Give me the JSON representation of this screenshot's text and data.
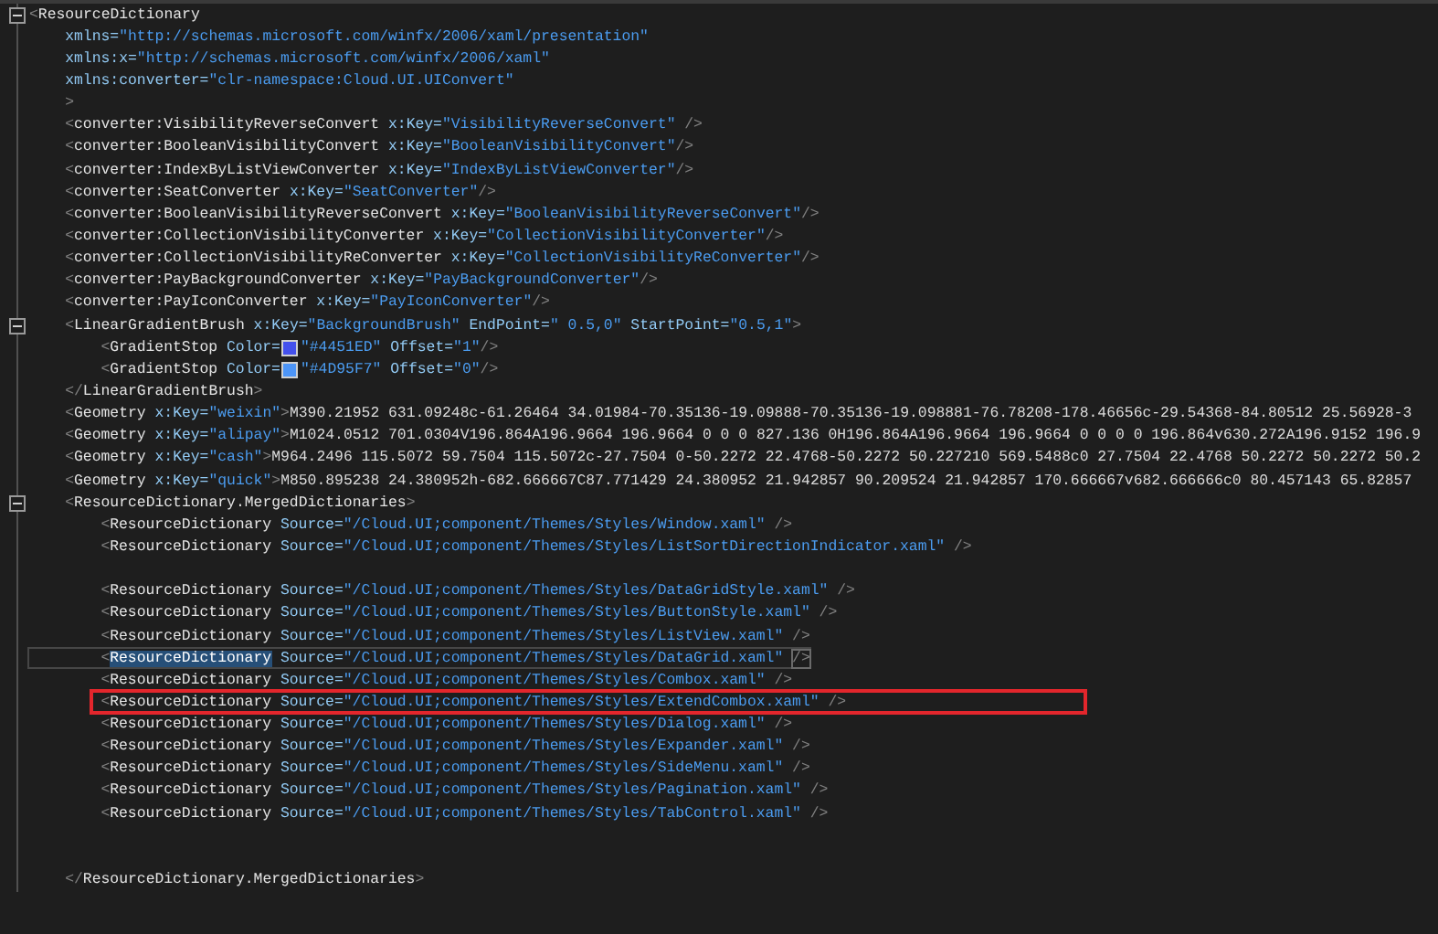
{
  "editor": {
    "lines": [
      {
        "kind": "code",
        "expanded": true,
        "tokens": [
          {
            "kind": "bracket",
            "text": "<"
          },
          {
            "kind": "tag",
            "text": "ResourceDictionary"
          }
        ],
        "children": [
          {
            "kind": "code",
            "tokens": [
              {
                "kind": "attr",
                "text": "xmlns="
              },
              {
                "kind": "value",
                "text": "\"http://schemas.microsoft.com/winfx/2006/xaml/presentation\""
              }
            ]
          },
          {
            "kind": "code",
            "tokens": [
              {
                "kind": "attr",
                "text": "xmlns:x="
              },
              {
                "kind": "value",
                "text": "\"http://schemas.microsoft.com/winfx/2006/xaml\""
              }
            ]
          },
          {
            "kind": "code",
            "tokens": [
              {
                "kind": "attr",
                "text": "xmlns:converter="
              },
              {
                "kind": "value",
                "text": "\"clr-namespace:Cloud.UI.UIConvert\""
              }
            ]
          },
          {
            "kind": "code",
            "tokens": [
              {
                "kind": "bracket",
                "text": ">"
              }
            ]
          },
          {
            "kind": "code",
            "tokens": [
              {
                "kind": "bracket",
                "text": "<"
              },
              {
                "kind": "tag",
                "text": "converter:VisibilityReverseConvert"
              },
              {
                "kind": "attr",
                "text": " x:Key="
              },
              {
                "kind": "value",
                "text": "\"VisibilityReverseConvert\""
              },
              {
                "kind": "bracket",
                "text": " />"
              }
            ]
          },
          {
            "kind": "code",
            "tokens": [
              {
                "kind": "bracket",
                "text": "<"
              },
              {
                "kind": "tag",
                "text": "converter:BooleanVisibilityConvert"
              },
              {
                "kind": "attr",
                "text": " x:Key="
              },
              {
                "kind": "value",
                "text": "\"BooleanVisibilityConvert\""
              },
              {
                "kind": "bracket",
                "text": "/>"
              }
            ]
          },
          {
            "kind": "code",
            "tokens": [
              {
                "kind": "bracket",
                "text": "<"
              },
              {
                "kind": "tag",
                "text": "converter:IndexByListViewConverter"
              },
              {
                "kind": "attr",
                "text": " x:Key="
              },
              {
                "kind": "value",
                "text": "\"IndexByListViewConverter\""
              },
              {
                "kind": "bracket",
                "text": "/>"
              }
            ]
          },
          {
            "kind": "code",
            "tokens": [
              {
                "kind": "bracket",
                "text": "<"
              },
              {
                "kind": "tag",
                "text": "converter:SeatConverter"
              },
              {
                "kind": "attr",
                "text": " x:Key="
              },
              {
                "kind": "value",
                "text": "\"SeatConverter\""
              },
              {
                "kind": "bracket",
                "text": "/>"
              }
            ]
          },
          {
            "kind": "code",
            "tokens": [
              {
                "kind": "bracket",
                "text": "<"
              },
              {
                "kind": "tag",
                "text": "converter:BooleanVisibilityReverseConvert"
              },
              {
                "kind": "attr",
                "text": " x:Key="
              },
              {
                "kind": "value",
                "text": "\"BooleanVisibilityReverseConvert\""
              },
              {
                "kind": "bracket",
                "text": "/>"
              }
            ]
          },
          {
            "kind": "code",
            "tokens": [
              {
                "kind": "bracket",
                "text": "<"
              },
              {
                "kind": "tag",
                "text": "converter:CollectionVisibilityConverter"
              },
              {
                "kind": "attr",
                "text": " x:Key="
              },
              {
                "kind": "value",
                "text": "\"CollectionVisibilityConverter\""
              },
              {
                "kind": "bracket",
                "text": "/>"
              }
            ]
          },
          {
            "kind": "code",
            "tokens": [
              {
                "kind": "bracket",
                "text": "<"
              },
              {
                "kind": "tag",
                "text": "converter:CollectionVisibilityReConverter"
              },
              {
                "kind": "attr",
                "text": " x:Key="
              },
              {
                "kind": "value",
                "text": "\"CollectionVisibilityReConverter\""
              },
              {
                "kind": "bracket",
                "text": "/>"
              }
            ]
          },
          {
            "kind": "code",
            "tokens": [
              {
                "kind": "bracket",
                "text": "<"
              },
              {
                "kind": "tag",
                "text": "converter:PayBackgroundConverter"
              },
              {
                "kind": "attr",
                "text": " x:Key="
              },
              {
                "kind": "value",
                "text": "\"PayBackgroundConverter\""
              },
              {
                "kind": "bracket",
                "text": "/>"
              }
            ]
          },
          {
            "kind": "code",
            "tokens": [
              {
                "kind": "bracket",
                "text": "<"
              },
              {
                "kind": "tag",
                "text": "converter:PayIconConverter"
              },
              {
                "kind": "attr",
                "text": " x:Key="
              },
              {
                "kind": "value",
                "text": "\"PayIconConverter\""
              },
              {
                "kind": "bracket",
                "text": "/>"
              }
            ]
          },
          {
            "kind": "code",
            "expanded": true,
            "tokens": [
              {
                "kind": "bracket",
                "text": "<"
              },
              {
                "kind": "tag",
                "text": "LinearGradientBrush"
              },
              {
                "kind": "attr",
                "text": " x:Key="
              },
              {
                "kind": "value",
                "text": "\"BackgroundBrush\""
              },
              {
                "kind": "attr",
                "text": " EndPoint="
              },
              {
                "kind": "value",
                "text": "\" 0.5,0\""
              },
              {
                "kind": "attr",
                "text": " StartPoint="
              },
              {
                "kind": "value",
                "text": "\"0.5,1\""
              },
              {
                "kind": "bracket",
                "text": ">"
              }
            ],
            "children": [
              {
                "kind": "code",
                "tokens": [
                  {
                    "kind": "bracket",
                    "text": "<"
                  },
                  {
                    "kind": "tag",
                    "text": "GradientStop"
                  },
                  {
                    "kind": "attr",
                    "text": " Color="
                  },
                  {
                    "kind": "swatch",
                    "color": "#4451ed"
                  },
                  {
                    "kind": "value",
                    "text": "\"#4451ED\""
                  },
                  {
                    "kind": "attr",
                    "text": " Offset="
                  },
                  {
                    "kind": "value",
                    "text": "\"1\""
                  },
                  {
                    "kind": "bracket",
                    "text": "/>"
                  }
                ]
              },
              {
                "kind": "code",
                "tokens": [
                  {
                    "kind": "bracket",
                    "text": "<"
                  },
                  {
                    "kind": "tag",
                    "text": "GradientStop"
                  },
                  {
                    "kind": "attr",
                    "text": " Color="
                  },
                  {
                    "kind": "swatch",
                    "color": "#4d95f7"
                  },
                  {
                    "kind": "value",
                    "text": "\"#4D95F7\""
                  },
                  {
                    "kind": "attr",
                    "text": " Offset="
                  },
                  {
                    "kind": "value",
                    "text": "\"0\""
                  },
                  {
                    "kind": "bracket",
                    "text": "/>"
                  }
                ]
              }
            ]
          },
          {
            "kind": "code",
            "tokens": [
              {
                "kind": "bracket",
                "text": "</"
              },
              {
                "kind": "tag",
                "text": "LinearGradientBrush"
              },
              {
                "kind": "bracket",
                "text": ">"
              }
            ]
          },
          {
            "kind": "code",
            "tokens": [
              {
                "kind": "bracket",
                "text": "<"
              },
              {
                "kind": "tag",
                "text": "Geometry"
              },
              {
                "kind": "attr",
                "text": " x:Key="
              },
              {
                "kind": "value",
                "text": "\"weixin\""
              },
              {
                "kind": "bracket",
                "text": ">"
              },
              {
                "kind": "text",
                "text": "M390.21952 631.09248c-61.26464 34.01984-70.35136-19.09888-70.35136-19.098881-76.78208-178.46656c-29.54368-84.80512 25.56928-3"
              }
            ]
          },
          {
            "kind": "code",
            "tokens": [
              {
                "kind": "bracket",
                "text": "<"
              },
              {
                "kind": "tag",
                "text": "Geometry"
              },
              {
                "kind": "attr",
                "text": " x:Key="
              },
              {
                "kind": "value",
                "text": "\"alipay\""
              },
              {
                "kind": "bracket",
                "text": ">"
              },
              {
                "kind": "text",
                "text": "M1024.0512 701.0304V196.864A196.9664 196.9664 0 0 0 827.136 0H196.864A196.9664 196.9664 0 0 0 0 196.864v630.272A196.9152 196.9"
              }
            ]
          },
          {
            "kind": "code",
            "tokens": [
              {
                "kind": "bracket",
                "text": "<"
              },
              {
                "kind": "tag",
                "text": "Geometry"
              },
              {
                "kind": "attr",
                "text": " x:Key="
              },
              {
                "kind": "value",
                "text": "\"cash\""
              },
              {
                "kind": "bracket",
                "text": ">"
              },
              {
                "kind": "text",
                "text": "M964.2496 115.5072 59.7504 115.5072c-27.7504 0-50.2272 22.4768-50.2272 50.227210 569.5488c0 27.7504 22.4768 50.2272 50.2272 50.2"
              }
            ]
          },
          {
            "kind": "code",
            "tokens": [
              {
                "kind": "bracket",
                "text": "<"
              },
              {
                "kind": "tag",
                "text": "Geometry"
              },
              {
                "kind": "attr",
                "text": " x:Key="
              },
              {
                "kind": "value",
                "text": "\"quick\""
              },
              {
                "kind": "bracket",
                "text": ">"
              },
              {
                "kind": "text",
                "text": "M850.895238 24.380952h-682.666667C87.771429 24.380952 21.942857 90.209524 21.942857 170.666667v682.666666c0 80.457143 65.82857"
              }
            ]
          },
          {
            "kind": "code",
            "expanded": true,
            "tokens": [
              {
                "kind": "bracket",
                "text": "<"
              },
              {
                "kind": "tag",
                "text": "ResourceDictionary.MergedDictionaries"
              },
              {
                "kind": "bracket",
                "text": ">"
              }
            ],
            "children": [
              {
                "kind": "code",
                "tokens": [
                  {
                    "kind": "bracket",
                    "text": "<"
                  },
                  {
                    "kind": "tag",
                    "text": "ResourceDictionary"
                  },
                  {
                    "kind": "attr",
                    "text": " Source="
                  },
                  {
                    "kind": "value",
                    "text": "\"/Cloud.UI;component/Themes/Styles/Window.xaml\""
                  },
                  {
                    "kind": "bracket",
                    "text": " />"
                  }
                ]
              },
              {
                "kind": "code",
                "tokens": [
                  {
                    "kind": "bracket",
                    "text": "<"
                  },
                  {
                    "kind": "tag",
                    "text": "ResourceDictionary"
                  },
                  {
                    "kind": "attr",
                    "text": " Source="
                  },
                  {
                    "kind": "value",
                    "text": "\"/Cloud.UI;component/Themes/Styles/ListSortDirectionIndicator.xaml\""
                  },
                  {
                    "kind": "bracket",
                    "text": " />"
                  }
                ]
              },
              {
                "kind": "blank"
              },
              {
                "kind": "code",
                "tokens": [
                  {
                    "kind": "bracket",
                    "text": "<"
                  },
                  {
                    "kind": "tag",
                    "text": "ResourceDictionary"
                  },
                  {
                    "kind": "attr",
                    "text": " Source="
                  },
                  {
                    "kind": "value",
                    "text": "\"/Cloud.UI;component/Themes/Styles/DataGridStyle.xaml\""
                  },
                  {
                    "kind": "bracket",
                    "text": " />"
                  }
                ]
              },
              {
                "kind": "code",
                "tokens": [
                  {
                    "kind": "bracket",
                    "text": "<"
                  },
                  {
                    "kind": "tag",
                    "text": "ResourceDictionary"
                  },
                  {
                    "kind": "attr",
                    "text": " Source="
                  },
                  {
                    "kind": "value",
                    "text": "\"/Cloud.UI;component/Themes/Styles/ButtonStyle.xaml\""
                  },
                  {
                    "kind": "bracket",
                    "text": " />"
                  }
                ]
              },
              {
                "kind": "code",
                "tokens": [
                  {
                    "kind": "bracket",
                    "text": "<"
                  },
                  {
                    "kind": "tag",
                    "text": "ResourceDictionary"
                  },
                  {
                    "kind": "attr",
                    "text": " Source="
                  },
                  {
                    "kind": "value",
                    "text": "\"/Cloud.UI;component/Themes/Styles/ListView.xaml\""
                  },
                  {
                    "kind": "bracket",
                    "text": " />"
                  }
                ]
              },
              {
                "kind": "current",
                "tokens": [
                  {
                    "kind": "bracket",
                    "text": "<"
                  },
                  {
                    "kind": "tag-match",
                    "text": "ResourceDictionary"
                  },
                  {
                    "kind": "attr",
                    "text": " Source="
                  },
                  {
                    "kind": "value",
                    "text": "\"/Cloud.UI;component/Themes/Styles/DataGrid.xaml\" "
                  },
                  {
                    "kind": "bracket-match",
                    "text": "/>"
                  }
                ]
              },
              {
                "kind": "code",
                "tokens": [
                  {
                    "kind": "bracket",
                    "text": "<"
                  },
                  {
                    "kind": "tag",
                    "text": "ResourceDictionary"
                  },
                  {
                    "kind": "attr",
                    "text": " Source="
                  },
                  {
                    "kind": "value",
                    "text": "\"/Cloud.UI;component/Themes/Styles/Combox.xaml\""
                  },
                  {
                    "kind": "bracket",
                    "text": " />"
                  }
                ]
              },
              {
                "kind": "marked",
                "tokens": [
                  {
                    "kind": "bracket",
                    "text": "<"
                  },
                  {
                    "kind": "tag",
                    "text": "ResourceDictionary"
                  },
                  {
                    "kind": "attr",
                    "text": " Source="
                  },
                  {
                    "kind": "value",
                    "text": "\"/Cloud.UI;component/Themes/Styles/ExtendCombox.xaml\""
                  },
                  {
                    "kind": "bracket",
                    "text": " />"
                  }
                ]
              },
              {
                "kind": "code",
                "tokens": [
                  {
                    "kind": "bracket",
                    "text": "<"
                  },
                  {
                    "kind": "tag",
                    "text": "ResourceDictionary"
                  },
                  {
                    "kind": "attr",
                    "text": " Source="
                  },
                  {
                    "kind": "value",
                    "text": "\"/Cloud.UI;component/Themes/Styles/Dialog.xaml\""
                  },
                  {
                    "kind": "bracket",
                    "text": " />"
                  }
                ]
              },
              {
                "kind": "code",
                "tokens": [
                  {
                    "kind": "bracket",
                    "text": "<"
                  },
                  {
                    "kind": "tag",
                    "text": "ResourceDictionary"
                  },
                  {
                    "kind": "attr",
                    "text": " Source="
                  },
                  {
                    "kind": "value",
                    "text": "\"/Cloud.UI;component/Themes/Styles/Expander.xaml\""
                  },
                  {
                    "kind": "bracket",
                    "text": " />"
                  }
                ]
              },
              {
                "kind": "code",
                "tokens": [
                  {
                    "kind": "bracket",
                    "text": "<"
                  },
                  {
                    "kind": "tag",
                    "text": "ResourceDictionary"
                  },
                  {
                    "kind": "attr",
                    "text": " Source="
                  },
                  {
                    "kind": "value",
                    "text": "\"/Cloud.UI;component/Themes/Styles/SideMenu.xaml\""
                  },
                  {
                    "kind": "bracket",
                    "text": " />"
                  }
                ]
              },
              {
                "kind": "code",
                "tokens": [
                  {
                    "kind": "bracket",
                    "text": "<"
                  },
                  {
                    "kind": "tag",
                    "text": "ResourceDictionary"
                  },
                  {
                    "kind": "attr",
                    "text": " Source="
                  },
                  {
                    "kind": "value",
                    "text": "\"/Cloud.UI;component/Themes/Styles/Pagination.xaml\""
                  },
                  {
                    "kind": "bracket",
                    "text": " />"
                  }
                ]
              },
              {
                "kind": "code",
                "tokens": [
                  {
                    "kind": "bracket",
                    "text": "<"
                  },
                  {
                    "kind": "tag",
                    "text": "ResourceDictionary"
                  },
                  {
                    "kind": "attr",
                    "text": " Source="
                  },
                  {
                    "kind": "value",
                    "text": "\"/Cloud.UI;component/Themes/Styles/TabControl.xaml\""
                  },
                  {
                    "kind": "bracket",
                    "text": " />"
                  }
                ]
              },
              {
                "kind": "blank"
              },
              {
                "kind": "blank"
              }
            ]
          },
          {
            "kind": "code",
            "tokens": [
              {
                "kind": "bracket",
                "text": "</"
              },
              {
                "kind": "tag",
                "text": "ResourceDictionary.MergedDictionaries"
              },
              {
                "kind": "bracket",
                "text": ">"
              }
            ]
          }
        ]
      }
    ]
  }
}
